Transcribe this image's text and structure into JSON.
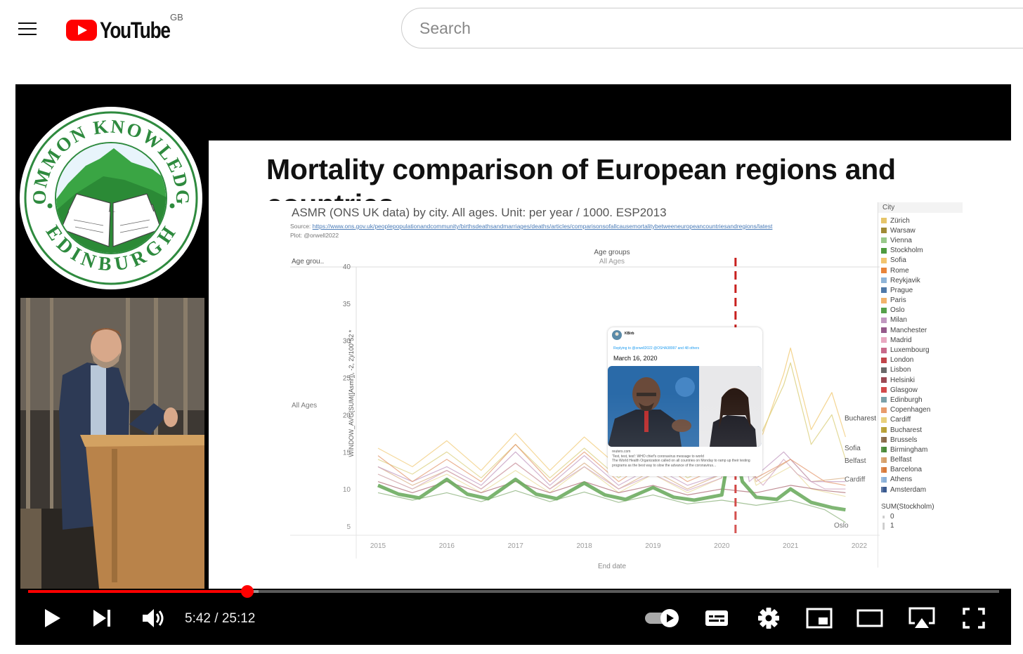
{
  "masthead": {
    "logo_text": "YouTube",
    "country_code": "GB",
    "search_placeholder": "Search"
  },
  "channel_badge": {
    "top_text": "COMMON KNOWLEDGE",
    "bottom_text": "EDINBURGH"
  },
  "slide": {
    "title": "Mortality comparison of European regions and countries",
    "chart": {
      "subtitle": "ASMR (ONS UK data) by city. All ages. Unit: per year / 1000. ESP2013",
      "source_label": "Source:",
      "source_url": "https://www.ons.gov.uk/peoplepopulationandcommunity/birthsdeathsandmarriages/deaths/articles/comparisonsofallcausemortalitybetweeneuropeancountriesandregions/latest",
      "plot_credit": "Plot: @orwell2022",
      "row_header": "Age grou..",
      "col_header": "Age groups",
      "col_value": "All Ages",
      "row_value": "All Ages",
      "ylabel": "WINDOW_AVG(SUM([Asmr]), -2, 2)/100*52 *",
      "xlabel": "End date",
      "legend_title": "City",
      "size_legend_title": "SUM(Stockholm)",
      "size_legend_values": [
        "0",
        "1"
      ],
      "end_labels": [
        "Bucharest",
        "Sofia",
        "Belfast",
        "Cardiff",
        "Oslo"
      ]
    },
    "tweet": {
      "user": "KBirb",
      "reply_to": "Replying to @orwell2022 @OSHA38997 and 48 others",
      "date": "March 16, 2020",
      "link_domain": "reuters.com",
      "link_title": "'Test, test, test': WHO chief's coronavirus message to world",
      "link_desc": "The World Health Organization called on all countries on Monday to ramp up their testing programs as the best way to slow the advance of the coronavirus..."
    }
  },
  "chart_data": {
    "type": "line",
    "title": "ASMR (ONS UK data) by city. All ages. Unit: per year / 1000. ESP2013",
    "xlabel": "End date",
    "ylabel": "WINDOW_AVG(SUM([Asmr]), -2, 2)/100*52 *",
    "xlim": [
      2015,
      2022
    ],
    "ylim": [
      5,
      40
    ],
    "x_ticks": [
      "2015",
      "2016",
      "2017",
      "2018",
      "2019",
      "2020",
      "2021",
      "2022"
    ],
    "y_ticks": [
      5,
      10,
      15,
      20,
      25,
      30,
      35,
      40
    ],
    "vline_x": 2020.2,
    "legend_placement": "right",
    "highlight_series": "Stockholm",
    "highlight_color": "#4e9a3e",
    "series": [
      {
        "name": "Stockholm",
        "color": "#4e9a3e",
        "x": [
          2015,
          2015.3,
          2015.6,
          2016,
          2016.3,
          2016.6,
          2017,
          2017.3,
          2017.6,
          2018,
          2018.3,
          2018.6,
          2019,
          2019.3,
          2019.6,
          2020,
          2020.15,
          2020.3,
          2020.5,
          2020.8,
          2021,
          2021.3,
          2021.6,
          2021.8
        ],
        "y": [
          10.5,
          9.3,
          8.8,
          11.3,
          9.3,
          8.7,
          11.3,
          9.3,
          8.7,
          10.8,
          9.2,
          8.6,
          10.2,
          8.9,
          8.5,
          9.2,
          17.3,
          11.0,
          8.9,
          8.6,
          10.0,
          8.2,
          7.5,
          7.2
        ]
      },
      {
        "name": "Bucharest",
        "color": "#f0c56a",
        "x": [
          2015,
          2015.5,
          2016,
          2016.5,
          2017,
          2017.5,
          2018,
          2018.5,
          2019,
          2019.5,
          2020,
          2020.3,
          2020.6,
          2020.9,
          2021,
          2021.3,
          2021.6,
          2021.8
        ],
        "y": [
          15.5,
          13,
          16.5,
          12.5,
          17.5,
          12.5,
          17,
          13,
          16.5,
          12.5,
          15,
          13,
          17.5,
          25.5,
          29,
          18,
          23,
          17
        ]
      },
      {
        "name": "Sofia",
        "color": "#d7c96e",
        "x": [
          2015,
          2015.5,
          2016,
          2016.5,
          2017,
          2017.5,
          2018,
          2018.5,
          2019,
          2019.5,
          2020,
          2020.3,
          2020.6,
          2020.9,
          2021,
          2021.3,
          2021.6,
          2021.8
        ],
        "y": [
          14,
          12,
          15,
          11.5,
          16,
          11.5,
          15.5,
          11.5,
          15,
          11.5,
          13.5,
          12,
          18,
          24,
          27,
          16,
          20,
          14
        ]
      },
      {
        "name": "Belfast",
        "color": "#d3a270",
        "x": [
          2015,
          2015.5,
          2016,
          2016.5,
          2017,
          2017.5,
          2018,
          2018.5,
          2019,
          2019.5,
          2020,
          2020.2,
          2020.5,
          2021,
          2021.3,
          2021.8
        ],
        "y": [
          13,
          10.5,
          12.5,
          10,
          13.5,
          10,
          13.5,
          10,
          12.5,
          10,
          12,
          20,
          11,
          14,
          11,
          11.5
        ]
      },
      {
        "name": "Cardiff",
        "color": "#e6d58a",
        "x": [
          2015,
          2015.5,
          2016,
          2016.5,
          2017,
          2017.5,
          2018,
          2018.5,
          2019,
          2019.5,
          2020,
          2020.2,
          2020.5,
          2021,
          2021.3,
          2021.8
        ],
        "y": [
          12,
          10,
          12,
          9.5,
          12.5,
          9.5,
          13,
          9.5,
          12,
          9.5,
          11.5,
          19,
          10.5,
          13,
          10,
          9
        ]
      },
      {
        "name": "Oslo",
        "color": "#6e9e5a",
        "x": [
          2015,
          2015.5,
          2016,
          2016.5,
          2017,
          2017.5,
          2018,
          2018.5,
          2019,
          2019.5,
          2020,
          2020.5,
          2021,
          2021.5,
          2021.8
        ],
        "y": [
          9.5,
          8.5,
          9.5,
          8.3,
          9.8,
          8.3,
          9.6,
          8.2,
          9.2,
          8,
          8.5,
          7.8,
          8.5,
          7.2,
          5.5
        ]
      },
      {
        "name": "Madrid",
        "color": "#c994b3",
        "x": [
          2015,
          2015.5,
          2016,
          2016.5,
          2017,
          2017.5,
          2018,
          2018.5,
          2019,
          2019.5,
          2020,
          2020.2,
          2020.35,
          2020.6,
          2020.9,
          2021.1,
          2021.5,
          2021.8
        ],
        "y": [
          12,
          10,
          12.5,
          10,
          13.5,
          10,
          13,
          10,
          12,
          9.8,
          11.5,
          25,
          13,
          10.5,
          14,
          12,
          10,
          10
        ]
      },
      {
        "name": "Milan",
        "color": "#b88ab5",
        "x": [
          2015,
          2015.5,
          2016,
          2016.5,
          2017,
          2017.5,
          2018,
          2018.5,
          2019,
          2019.5,
          2020,
          2020.2,
          2020.4,
          2020.9,
          2021.3,
          2021.8
        ],
        "y": [
          13,
          11,
          13,
          10.5,
          15,
          10.5,
          14.5,
          10.5,
          13,
          10.5,
          12,
          22,
          11,
          15,
          11,
          11
        ]
      },
      {
        "name": "Barcelona",
        "color": "#e08a5a",
        "x": [
          2015,
          2015.5,
          2016,
          2016.5,
          2017,
          2017.5,
          2018,
          2018.5,
          2019,
          2019.5,
          2020,
          2020.2,
          2020.5,
          2021,
          2021.5,
          2021.8
        ],
        "y": [
          14.5,
          11,
          14,
          11,
          16,
          11,
          15,
          11,
          14,
          11,
          13,
          20,
          11.5,
          14,
          11,
          10.5
        ]
      },
      {
        "name": "Helsinki",
        "color": "#9b4a54",
        "x": [
          2015,
          2015.5,
          2016,
          2016.5,
          2017,
          2017.5,
          2018,
          2018.5,
          2019,
          2019.5,
          2020,
          2020.5,
          2021,
          2021.5,
          2021.8
        ],
        "y": [
          11,
          9.5,
          11,
          9.5,
          11,
          9.5,
          11,
          9.5,
          10.5,
          9.2,
          10,
          9.5,
          10.5,
          9.8,
          9.5
        ]
      }
    ],
    "legend_entries": [
      {
        "name": "Zürich",
        "color": "#e6c56a"
      },
      {
        "name": "Warsaw",
        "color": "#a08a35"
      },
      {
        "name": "Vienna",
        "color": "#98c98a"
      },
      {
        "name": "Stockholm",
        "color": "#4e9a3e"
      },
      {
        "name": "Sofia",
        "color": "#f2c46e"
      },
      {
        "name": "Rome",
        "color": "#e8843a"
      },
      {
        "name": "Reykjavik",
        "color": "#8fb4d8"
      },
      {
        "name": "Prague",
        "color": "#4f79a8"
      },
      {
        "name": "Paris",
        "color": "#f2b36a"
      },
      {
        "name": "Oslo",
        "color": "#55a04a"
      },
      {
        "name": "Milan",
        "color": "#c098c0"
      },
      {
        "name": "Manchester",
        "color": "#955a8a"
      },
      {
        "name": "Madrid",
        "color": "#e8a8c0"
      },
      {
        "name": "Luxembourg",
        "color": "#c86a8a"
      },
      {
        "name": "London",
        "color": "#c0454a"
      },
      {
        "name": "Lisbon",
        "color": "#6a6a6a"
      },
      {
        "name": "Helsinki",
        "color": "#9b4a54"
      },
      {
        "name": "Glasgow",
        "color": "#d24a4a"
      },
      {
        "name": "Edinburgh",
        "color": "#7aa0a8"
      },
      {
        "name": "Copenhagen",
        "color": "#e89a6a"
      },
      {
        "name": "Cardiff",
        "color": "#e8d07a"
      },
      {
        "name": "Bucharest",
        "color": "#b8a035"
      },
      {
        "name": "Brussels",
        "color": "#8a6a4a"
      },
      {
        "name": "Birmingham",
        "color": "#4a8a3a"
      },
      {
        "name": "Belfast",
        "color": "#d6a06a"
      },
      {
        "name": "Barcelona",
        "color": "#d87a3a"
      },
      {
        "name": "Athens",
        "color": "#8ab0d8"
      },
      {
        "name": "Amsterdam",
        "color": "#3a5a90"
      }
    ]
  },
  "player": {
    "time_current": "5:42",
    "time_separator": " / ",
    "time_total": "25:12",
    "progress_played": 0.226,
    "progress_buffered": 0.237,
    "autoplay_on": true
  },
  "colors": {
    "brand_red": "#ff0000",
    "player_bg": "#000000",
    "badge_green": "#2e8a3e"
  }
}
